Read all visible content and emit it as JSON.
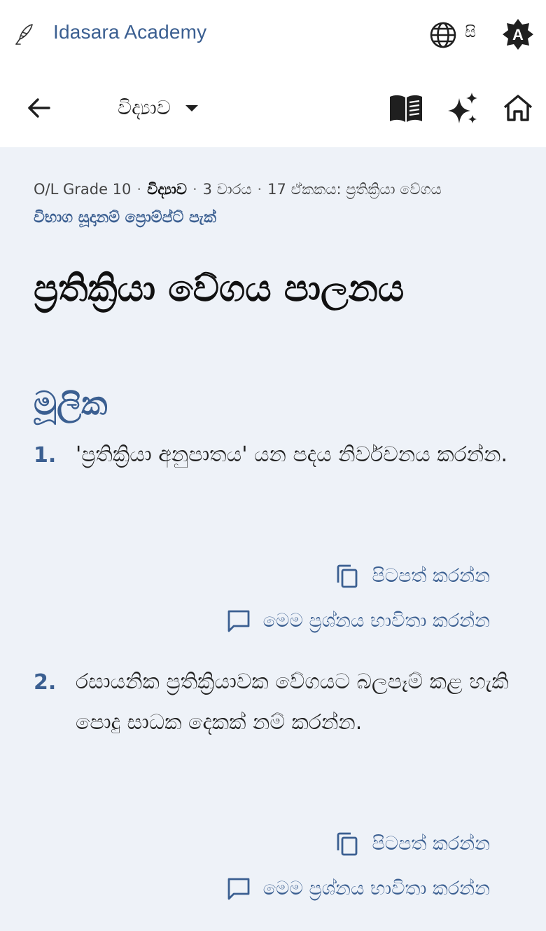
{
  "app": {
    "name": "Idasara Academy",
    "language": "සි",
    "theme_badge": "A"
  },
  "toolbar": {
    "subject": "විද්‍යාව"
  },
  "breadcrumb": {
    "grade": "O/L Grade 10",
    "subject": "විද්‍යාව",
    "term": "3 වාරය",
    "unit": "17 ඒකකය: ප්‍රතික්‍රියා වේගය"
  },
  "pack_link": "විභාග සූදානම් ප්‍රොම්ප්ට් පැක්",
  "page_title": "ප්‍රතික්‍රියා වේගය පාලනය",
  "section": {
    "title": "මූලික"
  },
  "actions": {
    "copy": "පිටපත් කරන්න",
    "use": "මෙම ප්‍රශ්නය භාවිතා කරන්න"
  },
  "questions": [
    {
      "number": "1.",
      "text": "'ප්‍රතික්‍රියා අනුපාතය' යන පදය නිර්වචනය කරන්න."
    },
    {
      "number": "2.",
      "text": "රසායනික ප්‍රතික්‍රියාවක වේගයට බලපෑම් කළ හැකි පොදු සාධක දෙකක් නම් කරන්න."
    }
  ],
  "colors": {
    "accent": "#3b5f91",
    "background": "#eef2f8",
    "surface": "#ffffff"
  },
  "icons": [
    "quill-pen-icon",
    "globe-icon",
    "theme-badge-icon",
    "back-arrow-icon",
    "caret-down-icon",
    "book-icon",
    "sparkle-icon",
    "home-icon",
    "copy-icon",
    "comment-icon"
  ]
}
